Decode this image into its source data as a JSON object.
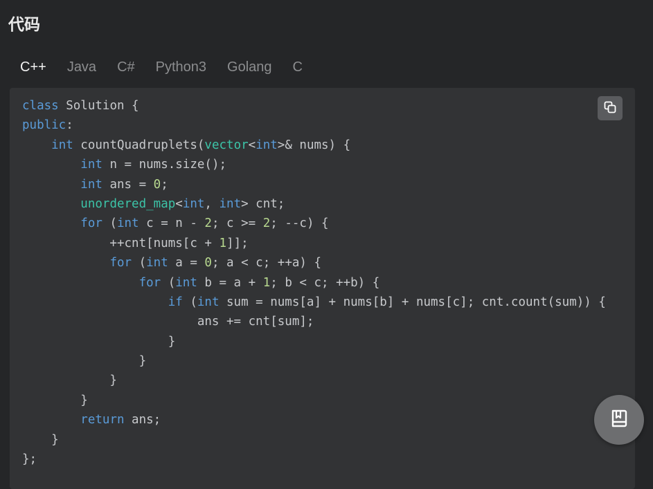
{
  "page": {
    "title": "代码"
  },
  "tabs": [
    {
      "label": "C++",
      "active": true
    },
    {
      "label": "Java",
      "active": false
    },
    {
      "label": "C#",
      "active": false
    },
    {
      "label": "Python3",
      "active": false
    },
    {
      "label": "Golang",
      "active": false
    },
    {
      "label": "C",
      "active": false
    }
  ],
  "code": {
    "language": "C++",
    "lines": [
      "class Solution {",
      "public:",
      "    int countQuadruplets(vector<int>& nums) {",
      "        int n = nums.size();",
      "        int ans = 0;",
      "        unordered_map<int, int> cnt;",
      "        for (int c = n - 2; c >= 2; --c) {",
      "            ++cnt[nums[c + 1]];",
      "            for (int a = 0; a < c; ++a) {",
      "                for (int b = a + 1; b < c; ++b) {",
      "                    if (int sum = nums[a] + nums[b] + nums[c]; cnt.count(sum)) {",
      "                        ans += cnt[sum];",
      "                    }",
      "                }",
      "            }",
      "        }",
      "        return ans;",
      "    }",
      "};"
    ]
  },
  "icons": {
    "copy": "copy-icon",
    "notebook": "notebook-icon"
  },
  "colors": {
    "background": "#252628",
    "code_background": "#323335",
    "keyword": "#5a9bd8",
    "type": "#3cc4a8",
    "number": "#b8d98f",
    "text": "#c7c9cc",
    "active_tab": "#f2f2f2",
    "inactive_tab": "#8c8d8f"
  }
}
